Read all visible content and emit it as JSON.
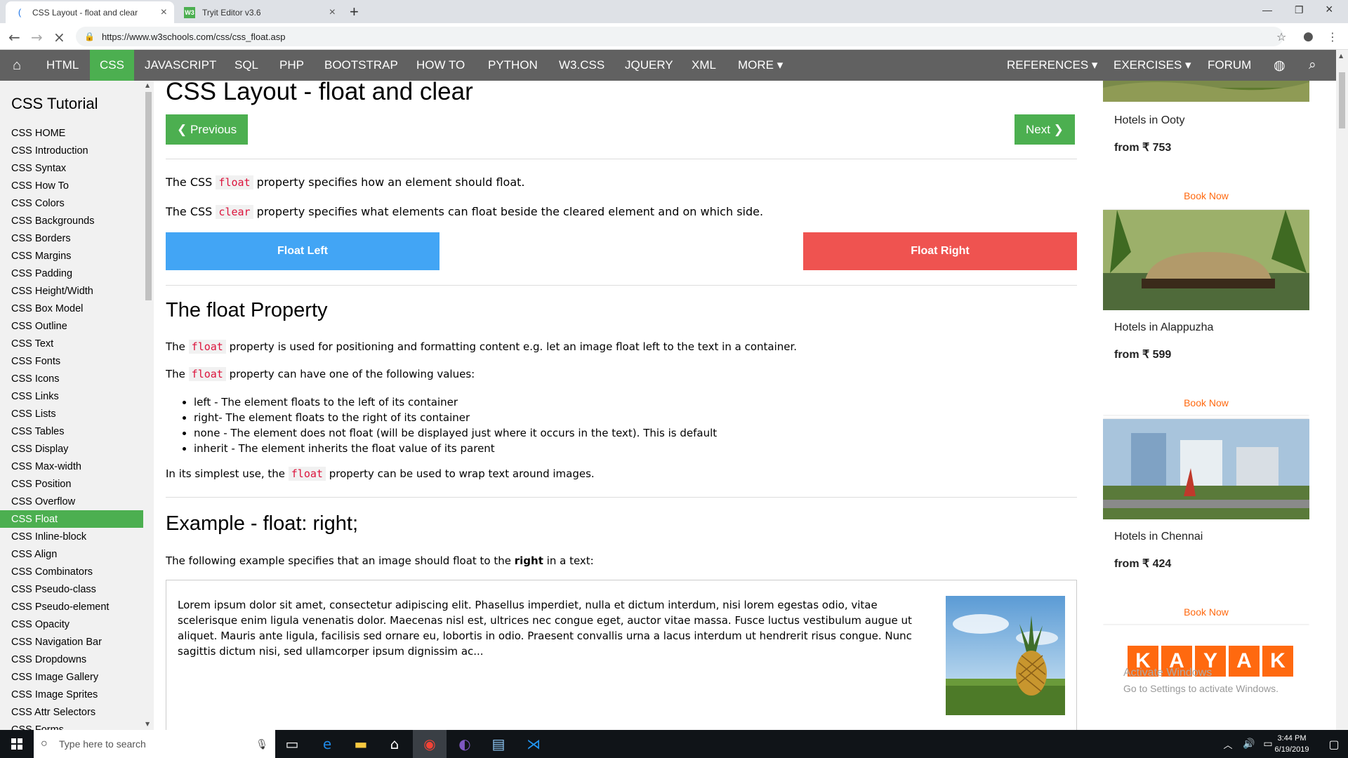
{
  "browser": {
    "tabs": [
      {
        "title": "CSS Layout - float and clear",
        "favicon": "w3-favicon",
        "active": true
      },
      {
        "title": "Tryit Editor v3.6",
        "favicon": "w3-favicon",
        "active": false
      }
    ],
    "new_tab": "+",
    "url": "https://www.w3schools.com/css/css_float.asp"
  },
  "topnav": {
    "home_icon": "home-icon",
    "items": [
      "HTML",
      "CSS",
      "JAVASCRIPT",
      "SQL",
      "PHP",
      "BOOTSTRAP",
      "HOW TO",
      "PYTHON",
      "W3.CSS",
      "JQUERY",
      "XML",
      "MORE ▾"
    ],
    "right_items": [
      "REFERENCES ▾",
      "EXERCISES ▾",
      "FORUM"
    ],
    "active": "CSS",
    "accent": "#4caf50"
  },
  "sidebar": {
    "title": "CSS Tutorial",
    "links": [
      "CSS HOME",
      "CSS Introduction",
      "CSS Syntax",
      "CSS How To",
      "CSS Colors",
      "CSS Backgrounds",
      "CSS Borders",
      "CSS Margins",
      "CSS Padding",
      "CSS Height/Width",
      "CSS Box Model",
      "CSS Outline",
      "CSS Text",
      "CSS Fonts",
      "CSS Icons",
      "CSS Links",
      "CSS Lists",
      "CSS Tables",
      "CSS Display",
      "CSS Max-width",
      "CSS Position",
      "CSS Overflow",
      "CSS Float",
      "CSS Inline-block",
      "CSS Align",
      "CSS Combinators",
      "CSS Pseudo-class",
      "CSS Pseudo-element",
      "CSS Opacity",
      "CSS Navigation Bar",
      "CSS Dropdowns",
      "CSS Image Gallery",
      "CSS Image Sprites",
      "CSS Attr Selectors",
      "CSS Forms"
    ],
    "active": "CSS Float"
  },
  "main": {
    "title": "CSS Layout - float and clear",
    "prev_label": "❮ Previous",
    "next_label": "Next ❯",
    "intro1": {
      "a": "The CSS ",
      "code": "float",
      "b": " property specifies how an element should float."
    },
    "intro2": {
      "a": "The CSS ",
      "code": "clear",
      "b": " property specifies what elements can float beside the cleared element and on which side."
    },
    "float_left": "Float Left",
    "float_right": "Float Right",
    "float_left_color": "#42a5f5",
    "float_right_color": "#ef5350",
    "section1_title": "The float Property",
    "s1p1": {
      "a": "The ",
      "code": "float",
      "b": " property is used for positioning and formatting content e.g. let an image float left to the text in a container."
    },
    "s1p2": {
      "a": "The ",
      "code": "float",
      "b": " property can have one of the following values:"
    },
    "values": [
      "left - The element floats to the left of its container",
      "right- The element floats to the right of its container",
      "none - The element does not float (will be displayed just where it occurs in the text). This is default",
      "inherit - The element inherits the float value of its parent"
    ],
    "s1p3": {
      "a": "In its simplest use, the ",
      "code": "float",
      "b": " property can be used to wrap text around images."
    },
    "section2_title": "Example - float: right;",
    "s2p1": {
      "a": "The following example specifies that an image should float to the ",
      "bold": "right",
      "b": " in a text:"
    },
    "example_text": "Lorem ipsum dolor sit amet, consectetur adipiscing elit. Phasellus imperdiet, nulla et dictum interdum, nisi lorem egestas odio, vitae scelerisque enim ligula venenatis dolor. Maecenas nisl est, ultrices nec congue eget, auctor vitae massa. Fusce luctus vestibulum augue ut aliquet. Mauris ante ligula, facilisis sed ornare eu, lobortis in odio. Praesent convallis urna a lacus interdum ut hendrerit risus congue. Nunc sagittis dictum nisi, sed ullamcorper ipsum dignissim ac..."
  },
  "ads": {
    "cards": [
      {
        "name": "Hotels in Ooty",
        "price": "from ₹ 753",
        "book": "Book Now"
      },
      {
        "name": "Hotels in Alappuzha",
        "price": "from ₹ 599",
        "book": "Book Now"
      },
      {
        "name": "Hotels in Chennai",
        "price": "from ₹ 424",
        "book": "Book Now"
      }
    ],
    "kayak": [
      "K",
      "A",
      "Y",
      "A",
      "K"
    ],
    "activate_line1": "Activate Windows",
    "activate_line2": "Go to Settings to activate Windows."
  },
  "taskbar": {
    "search_placeholder": "Type here to search",
    "time": "3:44 PM",
    "date": "6/19/2019"
  }
}
